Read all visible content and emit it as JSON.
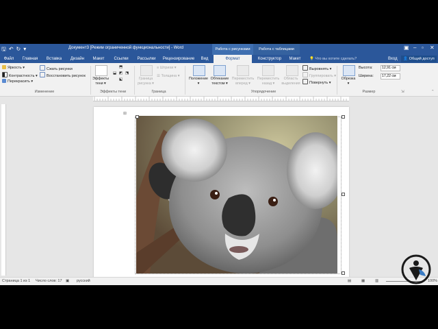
{
  "titlebar": {
    "doc_title": "Документ3 [Режим ограниченной функциональности] - Word",
    "context_picture": "Работа с рисунками",
    "context_table": "Работа с таблицами"
  },
  "tabs": [
    {
      "label": "Файл"
    },
    {
      "label": "Главная"
    },
    {
      "label": "Вставка"
    },
    {
      "label": "Дизайн"
    },
    {
      "label": "Макет"
    },
    {
      "label": "Ссылки"
    },
    {
      "label": "Рассылки"
    },
    {
      "label": "Рецензирование"
    },
    {
      "label": "Вид"
    },
    {
      "label": "Формат"
    },
    {
      "label": "Конструктор"
    },
    {
      "label": "Макет"
    }
  ],
  "tellme": "Что вы хотите сделать?",
  "signin": "Вход",
  "share": "Общий доступ",
  "ribbon": {
    "brightness": "Яркость",
    "contrast": "Контрастность",
    "recolor": "Перекрасить",
    "compress": "Сжать рисунки",
    "reset": "Восстановить рисунок",
    "group_changes": "Изменение",
    "shadow_effects_l1": "Эффекты",
    "shadow_effects_l2": "тени",
    "group_shadow": "Эффекты тени",
    "border_style_l1": "Граница",
    "border_style_l2": "рисунка",
    "dashes": "Штрихи",
    "weight": "Толщина",
    "group_border": "Граница",
    "position": "Положение",
    "wrap_l1": "Обтекание",
    "wrap_l2": "текстом",
    "bring_fwd_l1": "Переместить",
    "bring_fwd_l2": "вперед",
    "send_back_l1": "Переместить",
    "send_back_l2": "назад",
    "selection_l1": "Область",
    "selection_l2": "выделения",
    "align": "Выровнять",
    "group": "Группировать",
    "rotate": "Повернуть",
    "group_arrange": "Упорядочение",
    "crop": "Обрезка",
    "height_label": "Высота:",
    "height_value": "12,91 см",
    "width_label": "Ширина:",
    "width_value": "17,22 см",
    "group_size": "Размер"
  },
  "status": {
    "page": "Страница 1 из 1",
    "words": "Число слов: 17",
    "lang": "русский",
    "zoom": "100%"
  },
  "colors": {
    "word_blue": "#2b579a",
    "ribbon_bg": "#f1f1f1"
  }
}
